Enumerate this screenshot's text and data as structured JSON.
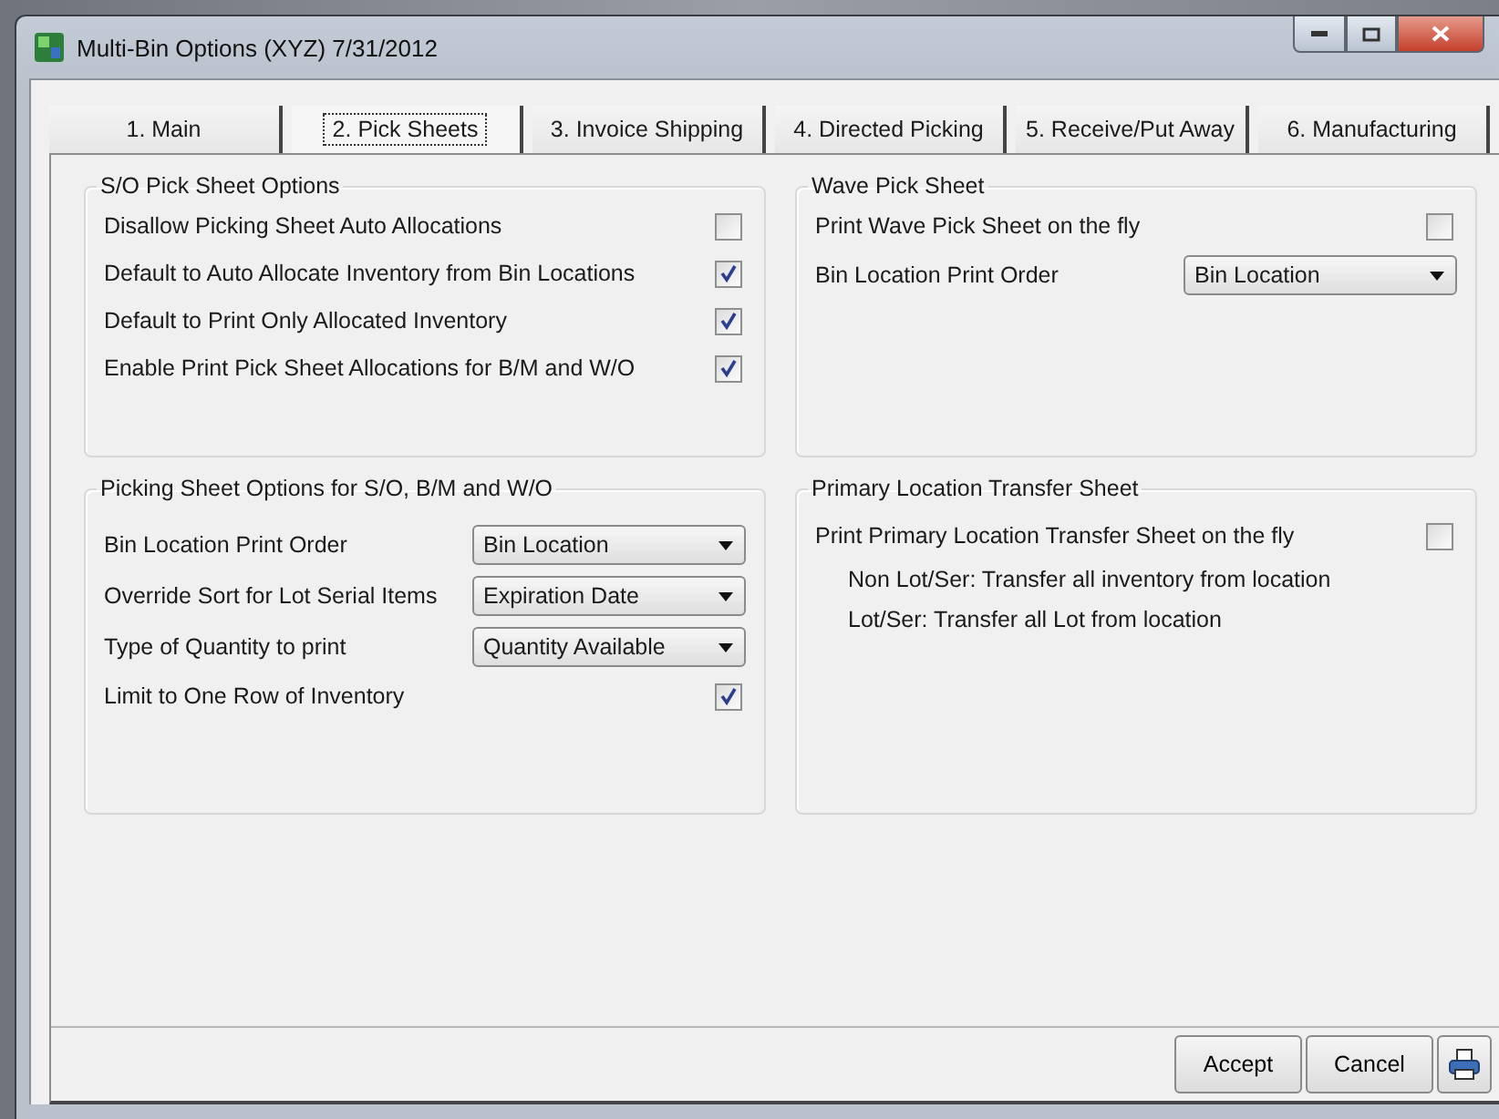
{
  "window": {
    "title": "Multi-Bin Options (XYZ) 7/31/2012"
  },
  "tabs": [
    {
      "label": "1. Main",
      "selected": false
    },
    {
      "label": "2. Pick Sheets",
      "selected": true
    },
    {
      "label": "3. Invoice Shipping",
      "selected": false
    },
    {
      "label": "4. Directed Picking",
      "selected": false
    },
    {
      "label": "5. Receive/Put Away",
      "selected": false
    },
    {
      "label": "6. Manufacturing",
      "selected": false
    }
  ],
  "columns": [
    {
      "groups": [
        {
          "title": "S/O Pick Sheet Options",
          "rows": [
            {
              "kind": "checkbox",
              "label": "Disallow Picking Sheet Auto Allocations",
              "checked": false
            },
            {
              "kind": "checkbox",
              "label": "Default to Auto Allocate Inventory from Bin Locations",
              "checked": true
            },
            {
              "kind": "checkbox",
              "label": "Default to Print Only Allocated Inventory",
              "checked": true
            },
            {
              "kind": "checkbox",
              "label": "Enable Print Pick Sheet Allocations for B/M and W/O",
              "checked": true
            }
          ]
        },
        {
          "title": "Picking Sheet Options for S/O, B/M and W/O",
          "rows": [
            {
              "kind": "select",
              "label": "Bin Location Print Order",
              "value": "Bin Location"
            },
            {
              "kind": "select",
              "label": "Override Sort for Lot Serial Items",
              "value": "Expiration Date"
            },
            {
              "kind": "select",
              "label": "Type of Quantity to print",
              "value": "Quantity Available"
            },
            {
              "kind": "checkbox",
              "label": "Limit to One Row of Inventory",
              "checked": true
            }
          ]
        }
      ]
    },
    {
      "groups": [
        {
          "title": "Wave Pick Sheet",
          "rows": [
            {
              "kind": "checkbox",
              "label": "Print Wave Pick Sheet on the fly",
              "checked": false
            },
            {
              "kind": "select",
              "label": "Bin Location Print Order",
              "value": "Bin Location"
            }
          ]
        },
        {
          "title": "Primary Location Transfer Sheet",
          "rows": [
            {
              "kind": "checkbox",
              "label": "Print Primary Location Transfer Sheet on the fly",
              "checked": false
            },
            {
              "kind": "note",
              "text": "Non Lot/Ser: Transfer all inventory from location"
            },
            {
              "kind": "note",
              "text": "Lot/Ser: Transfer all Lot from location"
            }
          ]
        }
      ]
    }
  ],
  "buttons": [
    "Accept",
    "Cancel"
  ]
}
